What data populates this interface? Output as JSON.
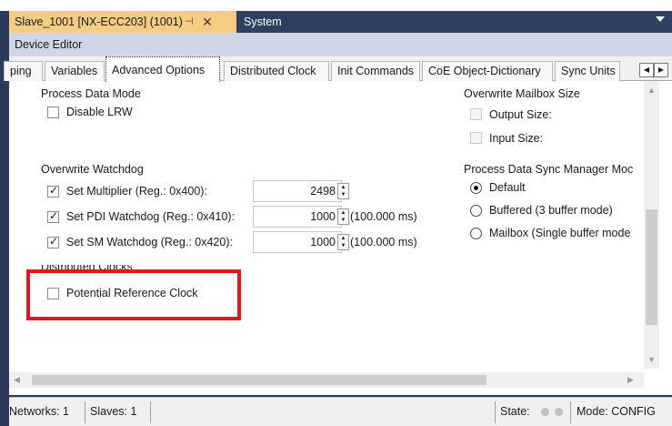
{
  "doc_tabs": [
    {
      "label": "Slave_1001 [NX-ECC203] (1001)",
      "active": true
    },
    {
      "label": "System",
      "active": false
    }
  ],
  "editor_title": "Device Editor",
  "editor_tabs": [
    "ping",
    "Variables",
    "Advanced Options",
    "Distributed Clock",
    "Init Commands",
    "CoE Object-Dictionary",
    "Sync Units"
  ],
  "active_editor_tab": "Advanced Options",
  "process_data_mode": {
    "heading": "Process Data Mode",
    "disable_lrw": {
      "label": "Disable LRW",
      "checked": false
    }
  },
  "overwrite_mailbox": {
    "heading": "Overwrite Mailbox Size",
    "output_size": {
      "label": "Output Size:",
      "checked": false,
      "enabled": false
    },
    "input_size": {
      "label": "Input Size:",
      "checked": false,
      "enabled": false
    }
  },
  "overwrite_watchdog": {
    "heading": "Overwrite Watchdog",
    "rows": [
      {
        "label": "Set Multiplier (Reg.: 0x400):",
        "checked": true,
        "value": "2498",
        "note": ""
      },
      {
        "label": "Set PDI Watchdog (Reg.: 0x410):",
        "checked": true,
        "value": "1000",
        "note": "(100.000 ms)"
      },
      {
        "label": "Set SM Watchdog (Reg.: 0x420):",
        "checked": true,
        "value": "1000",
        "note": "(100.000 ms)"
      }
    ]
  },
  "sync_manager_mode": {
    "heading": "Process Data Sync Manager Moc",
    "options": [
      {
        "label": "Default",
        "selected": true
      },
      {
        "label": "Buffered (3 buffer mode)",
        "selected": false
      },
      {
        "label": "Mailbox (Single buffer mode",
        "selected": false
      }
    ]
  },
  "distributed_clocks": {
    "heading": "Distributed Clocks",
    "potential_reference": {
      "label": "Potential Reference Clock",
      "checked": false
    }
  },
  "status_bar": {
    "networks": "Networks: 1",
    "slaves": "Slaves: 1",
    "state_label": "State:",
    "mode": "Mode: CONFIG"
  },
  "colors": {
    "active_doc_tab": "#f5cc84",
    "frame": "#2b3a5a",
    "highlight": "#e8151c"
  }
}
